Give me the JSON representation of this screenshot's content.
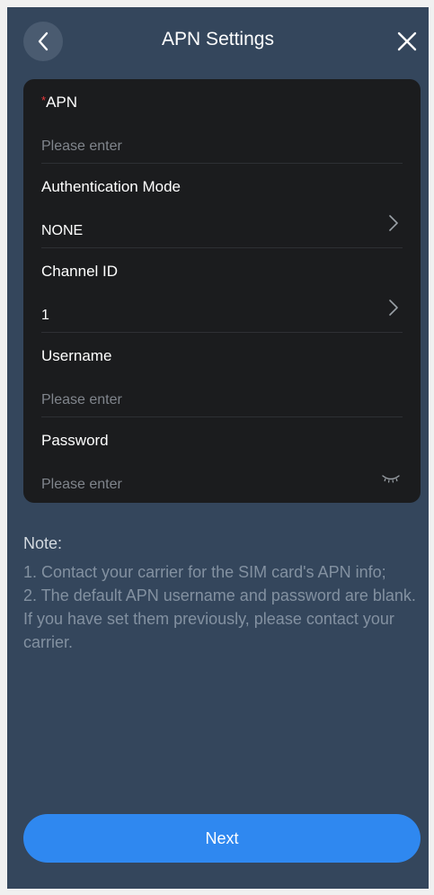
{
  "header": {
    "title": "APN Settings",
    "back_icon": "chevron-left-icon",
    "close_icon": "close-icon"
  },
  "form": {
    "apn": {
      "required_mark": "*",
      "label": "APN",
      "placeholder": "Please enter"
    },
    "auth_mode": {
      "label": "Authentication Mode",
      "value": "NONE"
    },
    "channel_id": {
      "label": "Channel ID",
      "value": "1"
    },
    "username": {
      "label": "Username",
      "placeholder": "Please enter"
    },
    "password": {
      "label": "Password",
      "placeholder": "Please enter",
      "icon": "eye-closed-icon"
    }
  },
  "note": {
    "title": "Note:",
    "line1": "1. Contact your carrier for the SIM card's APN info;",
    "line2": "2. The default APN username and password are blank. If you have set them previously, please contact your carrier."
  },
  "footer": {
    "next_label": "Next"
  },
  "colors": {
    "background": "#34465c",
    "card": "#1b1c1e",
    "accent": "#2f88f0",
    "required": "#e5383b"
  }
}
